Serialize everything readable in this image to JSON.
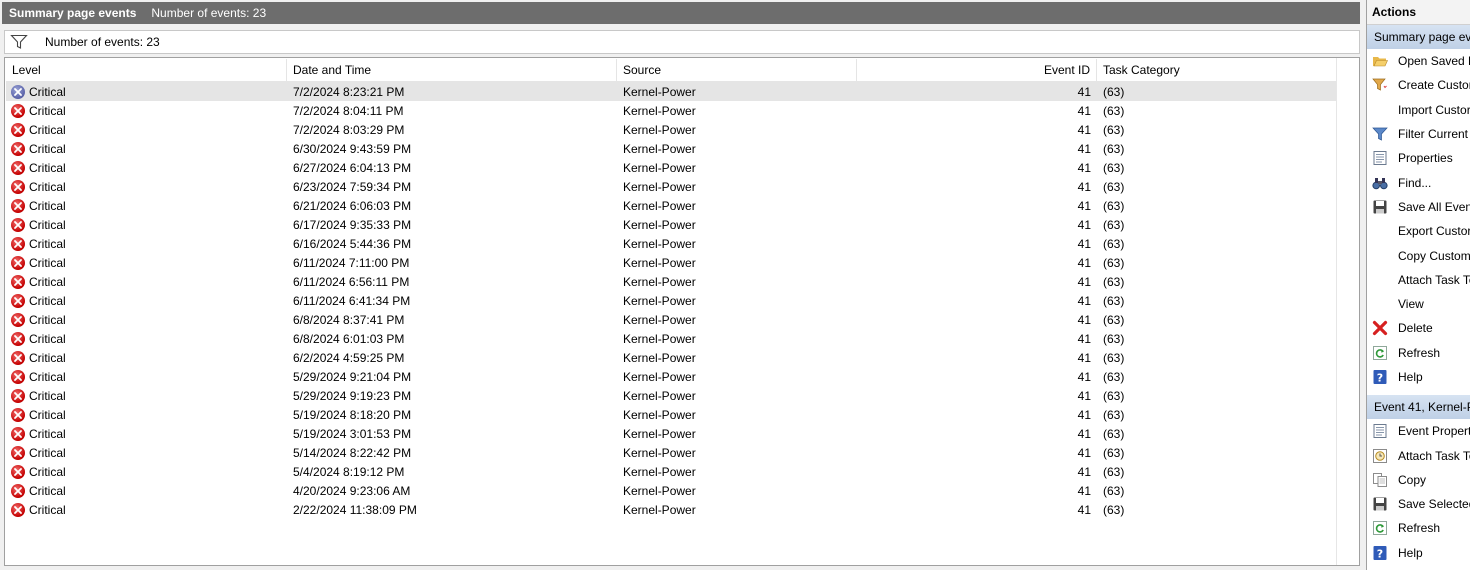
{
  "window": {
    "title": "Summary page events",
    "event_count_text": "Number of events: 23"
  },
  "filter_bar": {
    "text": "Number of events: 23",
    "icon": "filter-icon"
  },
  "table": {
    "columns": [
      "Level",
      "Date and Time",
      "Source",
      "Event ID",
      "Task Category"
    ],
    "rows": [
      {
        "level": "Critical",
        "datetime": "7/2/2024 8:23:21 PM",
        "source": "Kernel-Power",
        "event_id": "41",
        "task": "(63)",
        "selected": true
      },
      {
        "level": "Critical",
        "datetime": "7/2/2024 8:04:11 PM",
        "source": "Kernel-Power",
        "event_id": "41",
        "task": "(63)"
      },
      {
        "level": "Critical",
        "datetime": "7/2/2024 8:03:29 PM",
        "source": "Kernel-Power",
        "event_id": "41",
        "task": "(63)"
      },
      {
        "level": "Critical",
        "datetime": "6/30/2024 9:43:59 PM",
        "source": "Kernel-Power",
        "event_id": "41",
        "task": "(63)"
      },
      {
        "level": "Critical",
        "datetime": "6/27/2024 6:04:13 PM",
        "source": "Kernel-Power",
        "event_id": "41",
        "task": "(63)"
      },
      {
        "level": "Critical",
        "datetime": "6/23/2024 7:59:34 PM",
        "source": "Kernel-Power",
        "event_id": "41",
        "task": "(63)"
      },
      {
        "level": "Critical",
        "datetime": "6/21/2024 6:06:03 PM",
        "source": "Kernel-Power",
        "event_id": "41",
        "task": "(63)"
      },
      {
        "level": "Critical",
        "datetime": "6/17/2024 9:35:33 PM",
        "source": "Kernel-Power",
        "event_id": "41",
        "task": "(63)"
      },
      {
        "level": "Critical",
        "datetime": "6/16/2024 5:44:36 PM",
        "source": "Kernel-Power",
        "event_id": "41",
        "task": "(63)"
      },
      {
        "level": "Critical",
        "datetime": "6/11/2024 7:11:00 PM",
        "source": "Kernel-Power",
        "event_id": "41",
        "task": "(63)"
      },
      {
        "level": "Critical",
        "datetime": "6/11/2024 6:56:11 PM",
        "source": "Kernel-Power",
        "event_id": "41",
        "task": "(63)"
      },
      {
        "level": "Critical",
        "datetime": "6/11/2024 6:41:34 PM",
        "source": "Kernel-Power",
        "event_id": "41",
        "task": "(63)"
      },
      {
        "level": "Critical",
        "datetime": "6/8/2024 8:37:41 PM",
        "source": "Kernel-Power",
        "event_id": "41",
        "task": "(63)"
      },
      {
        "level": "Critical",
        "datetime": "6/8/2024 6:01:03 PM",
        "source": "Kernel-Power",
        "event_id": "41",
        "task": "(63)"
      },
      {
        "level": "Critical",
        "datetime": "6/2/2024 4:59:25 PM",
        "source": "Kernel-Power",
        "event_id": "41",
        "task": "(63)"
      },
      {
        "level": "Critical",
        "datetime": "5/29/2024 9:21:04 PM",
        "source": "Kernel-Power",
        "event_id": "41",
        "task": "(63)"
      },
      {
        "level": "Critical",
        "datetime": "5/29/2024 9:19:23 PM",
        "source": "Kernel-Power",
        "event_id": "41",
        "task": "(63)"
      },
      {
        "level": "Critical",
        "datetime": "5/19/2024 8:18:20 PM",
        "source": "Kernel-Power",
        "event_id": "41",
        "task": "(63)"
      },
      {
        "level": "Critical",
        "datetime": "5/19/2024 3:01:53 PM",
        "source": "Kernel-Power",
        "event_id": "41",
        "task": "(63)"
      },
      {
        "level": "Critical",
        "datetime": "5/14/2024 8:22:42 PM",
        "source": "Kernel-Power",
        "event_id": "41",
        "task": "(63)"
      },
      {
        "level": "Critical",
        "datetime": "5/4/2024 8:19:12 PM",
        "source": "Kernel-Power",
        "event_id": "41",
        "task": "(63)"
      },
      {
        "level": "Critical",
        "datetime": "4/20/2024 9:23:06 AM",
        "source": "Kernel-Power",
        "event_id": "41",
        "task": "(63)"
      },
      {
        "level": "Critical",
        "datetime": "2/22/2024 11:38:09 PM",
        "source": "Kernel-Power",
        "event_id": "41",
        "task": "(63)"
      }
    ]
  },
  "actions": {
    "header": "Actions",
    "sections": [
      {
        "title": "Summary page ev",
        "items": [
          {
            "label": "Open Saved L",
            "icon": "folder-open-icon"
          },
          {
            "label": "Create Custor",
            "icon": "create-filter-icon"
          },
          {
            "label": "Import Custor",
            "icon": ""
          },
          {
            "label": "Filter Current",
            "icon": "filter-icon"
          },
          {
            "label": "Properties",
            "icon": "properties-icon"
          },
          {
            "label": "Find...",
            "icon": "binoculars-icon"
          },
          {
            "label": "Save All Event",
            "icon": "save-icon"
          },
          {
            "label": "Export Custor",
            "icon": ""
          },
          {
            "label": "Copy Custom",
            "icon": ""
          },
          {
            "label": "Attach Task To",
            "icon": ""
          },
          {
            "label": "View",
            "icon": ""
          },
          {
            "label": "Delete",
            "icon": "delete-icon"
          },
          {
            "label": "Refresh",
            "icon": "refresh-icon"
          },
          {
            "label": "Help",
            "icon": "help-icon"
          }
        ]
      },
      {
        "title": "Event 41, Kernel-P",
        "items": [
          {
            "label": "Event Propert",
            "icon": "properties-icon"
          },
          {
            "label": "Attach Task To",
            "icon": "task-clock-icon"
          },
          {
            "label": "Copy",
            "icon": "copy-icon"
          },
          {
            "label": "Save Selected",
            "icon": "save-icon"
          },
          {
            "label": "Refresh",
            "icon": "refresh-icon"
          },
          {
            "label": "Help",
            "icon": "help-icon"
          }
        ]
      }
    ]
  }
}
